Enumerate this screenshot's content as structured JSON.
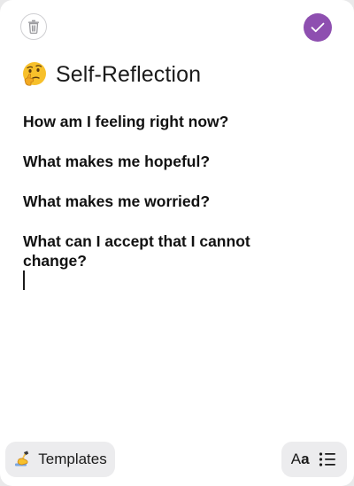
{
  "colors": {
    "accent": "#8e4fb0",
    "background": "#ffffff",
    "chip_background": "#ececee",
    "text": "#111111"
  },
  "toolbar": {
    "delete_icon": "trash-icon",
    "done_icon": "checkmark-icon"
  },
  "note": {
    "title_icon": "thinking-face-emoji",
    "title": "Self-Reflection",
    "questions": [
      "How am I feeling right now?",
      "What makes me hopeful?",
      "What makes me worried?",
      "What can I accept that I cannot change?"
    ]
  },
  "bottom_bar": {
    "templates_icon": "writing-hand-emoji",
    "templates_label": "Templates",
    "text_format_big": "A",
    "text_format_small": "a",
    "list_icon": "bullet-list-icon"
  }
}
